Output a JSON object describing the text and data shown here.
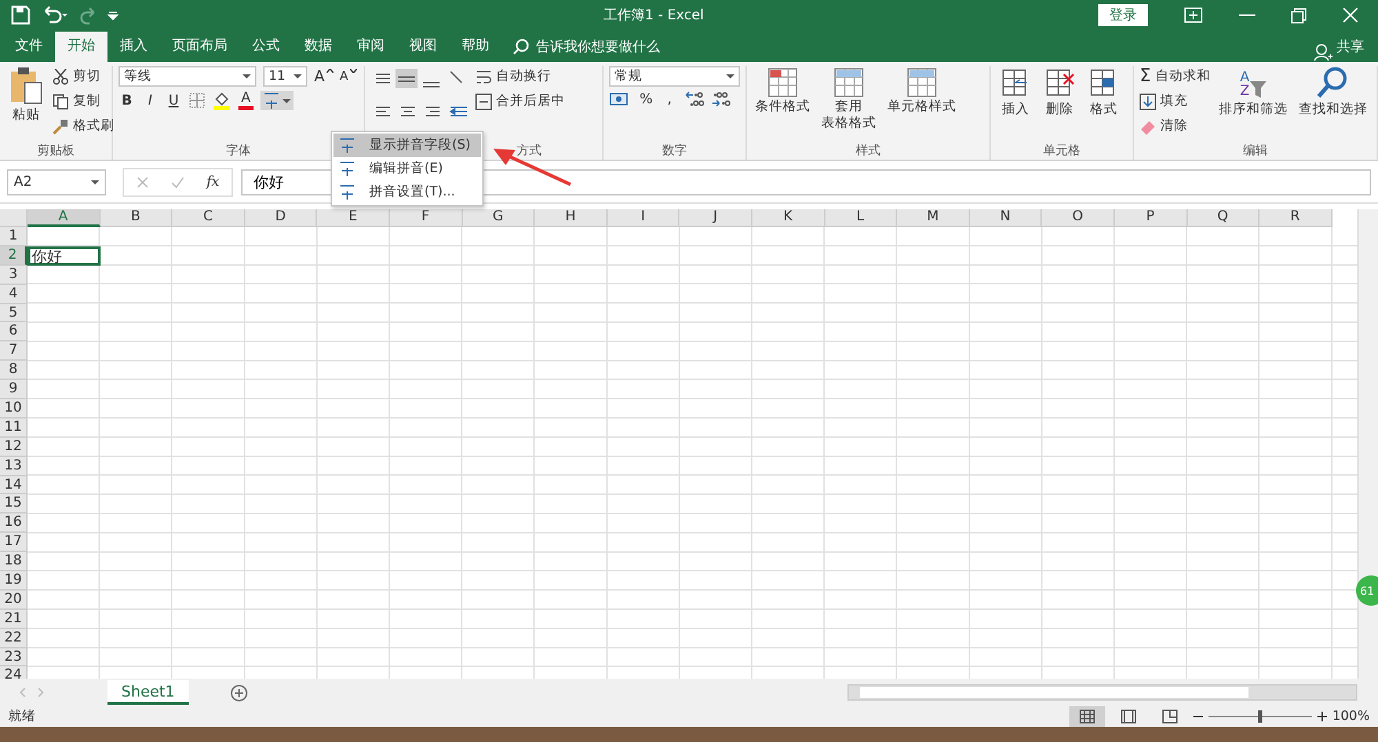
{
  "title_bar": {
    "title": "工作簿1  -  Excel",
    "login": "登录"
  },
  "menu_tabs": [
    {
      "label": "文件",
      "selected": false
    },
    {
      "label": "开始",
      "selected": true
    },
    {
      "label": "插入",
      "selected": false
    },
    {
      "label": "页面布局",
      "selected": false
    },
    {
      "label": "公式",
      "selected": false
    },
    {
      "label": "数据",
      "selected": false
    },
    {
      "label": "审阅",
      "selected": false
    },
    {
      "label": "视图",
      "selected": false
    },
    {
      "label": "帮助",
      "selected": false
    }
  ],
  "tell_me": "告诉我你想要做什么",
  "share": "共享",
  "clipboard": {
    "paste": "粘贴",
    "cut": "剪切",
    "copy": "复制",
    "format_painter": "格式刷",
    "label": "剪贴板"
  },
  "font": {
    "name": "等线",
    "size": "11",
    "grow": "A",
    "shrink": "A",
    "bold": "B",
    "italic": "I",
    "underline": "U",
    "color_letter": "A",
    "label": "字体"
  },
  "alignment": {
    "wrap": "自动换行",
    "merge": "合并后居中",
    "label": "方式"
  },
  "number": {
    "format": "常规",
    "percent": "%",
    "comma": ",",
    "label": "数字"
  },
  "styles": {
    "buttons": [
      [
        "条件格式"
      ],
      [
        "套用",
        "表格格式"
      ],
      [
        "单元格样式"
      ]
    ],
    "label": "样式"
  },
  "cells": {
    "buttons": [
      "插入",
      "删除",
      "格式"
    ],
    "label": "单元格"
  },
  "editing": {
    "sigma": "Σ",
    "autosum": "自动求和",
    "fill": "填充",
    "clear": "清除",
    "sort_letters": [
      "A",
      "Z"
    ],
    "sort": "排序和筛选",
    "find": "查找和选择",
    "label": "编辑"
  },
  "phonetic_menu": [
    {
      "label": "显示拼音字段(S)",
      "selected": true
    },
    {
      "label": "编辑拼音(E)",
      "selected": false
    },
    {
      "label": "拼音设置(T)...",
      "selected": false
    }
  ],
  "formula_bar": {
    "name_box": "A2",
    "fx": "fx",
    "value": "你好"
  },
  "sheet": {
    "columns": [
      {
        "label": "A",
        "selected": true
      },
      {
        "label": "B",
        "selected": false
      },
      {
        "label": "C",
        "selected": false
      },
      {
        "label": "D",
        "selected": false
      },
      {
        "label": "E",
        "selected": false
      },
      {
        "label": "F",
        "selected": false
      },
      {
        "label": "G",
        "selected": false
      },
      {
        "label": "H",
        "selected": false
      },
      {
        "label": "I",
        "selected": false
      },
      {
        "label": "J",
        "selected": false
      },
      {
        "label": "K",
        "selected": false
      },
      {
        "label": "L",
        "selected": false
      },
      {
        "label": "M",
        "selected": false
      },
      {
        "label": "N",
        "selected": false
      },
      {
        "label": "O",
        "selected": false
      },
      {
        "label": "P",
        "selected": false
      },
      {
        "label": "Q",
        "selected": false
      },
      {
        "label": "R",
        "selected": false
      }
    ],
    "rows": [
      {
        "label": "1",
        "selected": false,
        "cells": []
      },
      {
        "label": "2",
        "selected": true,
        "cells": [
          {
            "text": "你好",
            "selected": true
          }
        ]
      },
      {
        "label": "3",
        "selected": false,
        "cells": []
      },
      {
        "label": "4",
        "selected": false,
        "cells": []
      },
      {
        "label": "5",
        "selected": false,
        "cells": []
      },
      {
        "label": "6",
        "selected": false,
        "cells": []
      },
      {
        "label": "7",
        "selected": false,
        "cells": []
      },
      {
        "label": "8",
        "selected": false,
        "cells": []
      },
      {
        "label": "9",
        "selected": false,
        "cells": []
      },
      {
        "label": "10",
        "selected": false,
        "cells": []
      },
      {
        "label": "11",
        "selected": false,
        "cells": []
      },
      {
        "label": "12",
        "selected": false,
        "cells": []
      },
      {
        "label": "13",
        "selected": false,
        "cells": []
      },
      {
        "label": "14",
        "selected": false,
        "cells": []
      },
      {
        "label": "15",
        "selected": false,
        "cells": []
      },
      {
        "label": "16",
        "selected": false,
        "cells": []
      },
      {
        "label": "17",
        "selected": false,
        "cells": []
      },
      {
        "label": "18",
        "selected": false,
        "cells": []
      },
      {
        "label": "19",
        "selected": false,
        "cells": []
      },
      {
        "label": "20",
        "selected": false,
        "cells": []
      },
      {
        "label": "21",
        "selected": false,
        "cells": []
      },
      {
        "label": "22",
        "selected": false,
        "cells": []
      },
      {
        "label": "23",
        "selected": false,
        "cells": []
      },
      {
        "label": "24",
        "selected": false,
        "cells": []
      }
    ]
  },
  "sheet_tabs": [
    {
      "label": "Sheet1",
      "selected": true
    }
  ],
  "status_bar": {
    "status": "就绪",
    "zoom": "100%",
    "level": 0.5
  },
  "badge": "61"
}
